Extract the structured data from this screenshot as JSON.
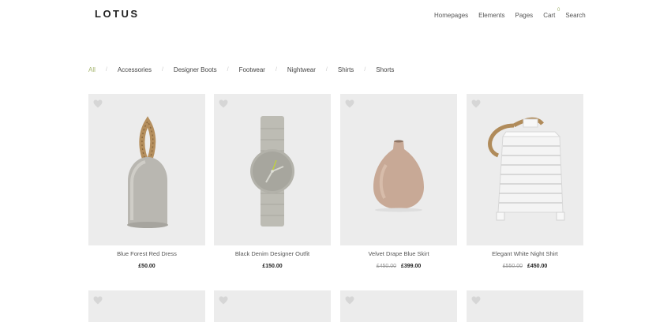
{
  "brand": {
    "logo": "LOTUS"
  },
  "nav": {
    "items": [
      {
        "label": "Homepages"
      },
      {
        "label": "Elements"
      },
      {
        "label": "Pages"
      },
      {
        "label": "Cart"
      },
      {
        "label": "Search"
      }
    ],
    "cart_count": "0"
  },
  "filters": [
    "All",
    "Accessories",
    "Designer Boots",
    "Footwear",
    "Nightwear",
    "Shirts",
    "Shorts"
  ],
  "products": [
    {
      "name": "Blue Forest Red Dress",
      "price": "£50.00",
      "old_price": ""
    },
    {
      "name": "Black Denim Designer Outfit",
      "price": "£150.00",
      "old_price": ""
    },
    {
      "name": "Velvet Drape Blue Skirt",
      "price": "£399.00",
      "old_price": "£450.00"
    },
    {
      "name": "Elegant White Night Shirt",
      "price": "£450.00",
      "old_price": "£550.00"
    }
  ],
  "colors": {
    "accent": "#a4b36b",
    "card_bg": "#ececec"
  }
}
